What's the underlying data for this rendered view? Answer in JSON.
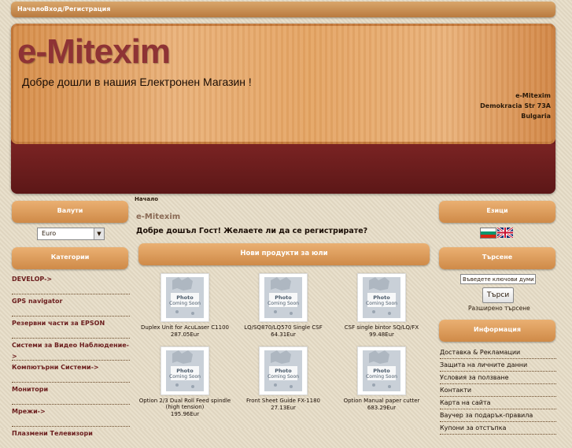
{
  "nav": {
    "home": "Начало",
    "login": "Вход/Регистрация"
  },
  "header": {
    "title": "e-Mitexim",
    "subtitle": "Добре дошли в нашия Електронен Магазин !",
    "address": [
      "e-Mitexim",
      "Demokracia Str 73A",
      "Bulgaria"
    ]
  },
  "left": {
    "currency_title": "Валути",
    "currency_value": "Euro",
    "categories_title": "Категории",
    "categories": [
      "DEVELOP->",
      "GPS navigator",
      "Резервни части за EPSON",
      "Системи за Видео Наблюдение->",
      "Компютърни Системи->",
      "Монитори",
      "Мрежи->",
      "Плазмени Телевизори"
    ]
  },
  "main": {
    "breadcrumb": "Начало",
    "store_name": "e-Mitexim",
    "greeting": "Добре дошъл Гост! Желаете ли да се регистрирате?",
    "new_products_title": "Нови продукти за юли",
    "placeholder_image_text": "Photo Coming Soon",
    "products": [
      {
        "name": "Duplex Unit for AcuLaser C1100",
        "price": "287.05Eur"
      },
      {
        "name": "LQ/SQ870/LQ570 Single CSF",
        "price": "64.31Eur"
      },
      {
        "name": "CSF single bintor SQ/LQ/FX",
        "price": "99.48Eur"
      },
      {
        "name": "Option 2/3 Dual Roll Feed spindle (high tension)",
        "price": "195.96Eur"
      },
      {
        "name": "Front Sheet Guide FX-1180",
        "price": "27.13Eur"
      },
      {
        "name": "Option Manual paper cutter",
        "price": "683.29Eur"
      }
    ]
  },
  "right": {
    "languages_title": "Езици",
    "search_title": "Търсене",
    "search_placeholder": "Въведете ключови думи",
    "search_button": "Търси",
    "advanced_search": "Разширено търсене",
    "info_title": "Информация",
    "info_links": [
      "Доставка & Рекламации",
      "Защита на личните данни",
      "Условия за ползване",
      "Контакти",
      "Карта на сайта",
      "Ваучер за подарък-правила",
      "Купони за отстъпка"
    ]
  },
  "colors": {
    "accent": "#cf8a48",
    "title": "#8e3335",
    "band": "#6e1d1d"
  }
}
